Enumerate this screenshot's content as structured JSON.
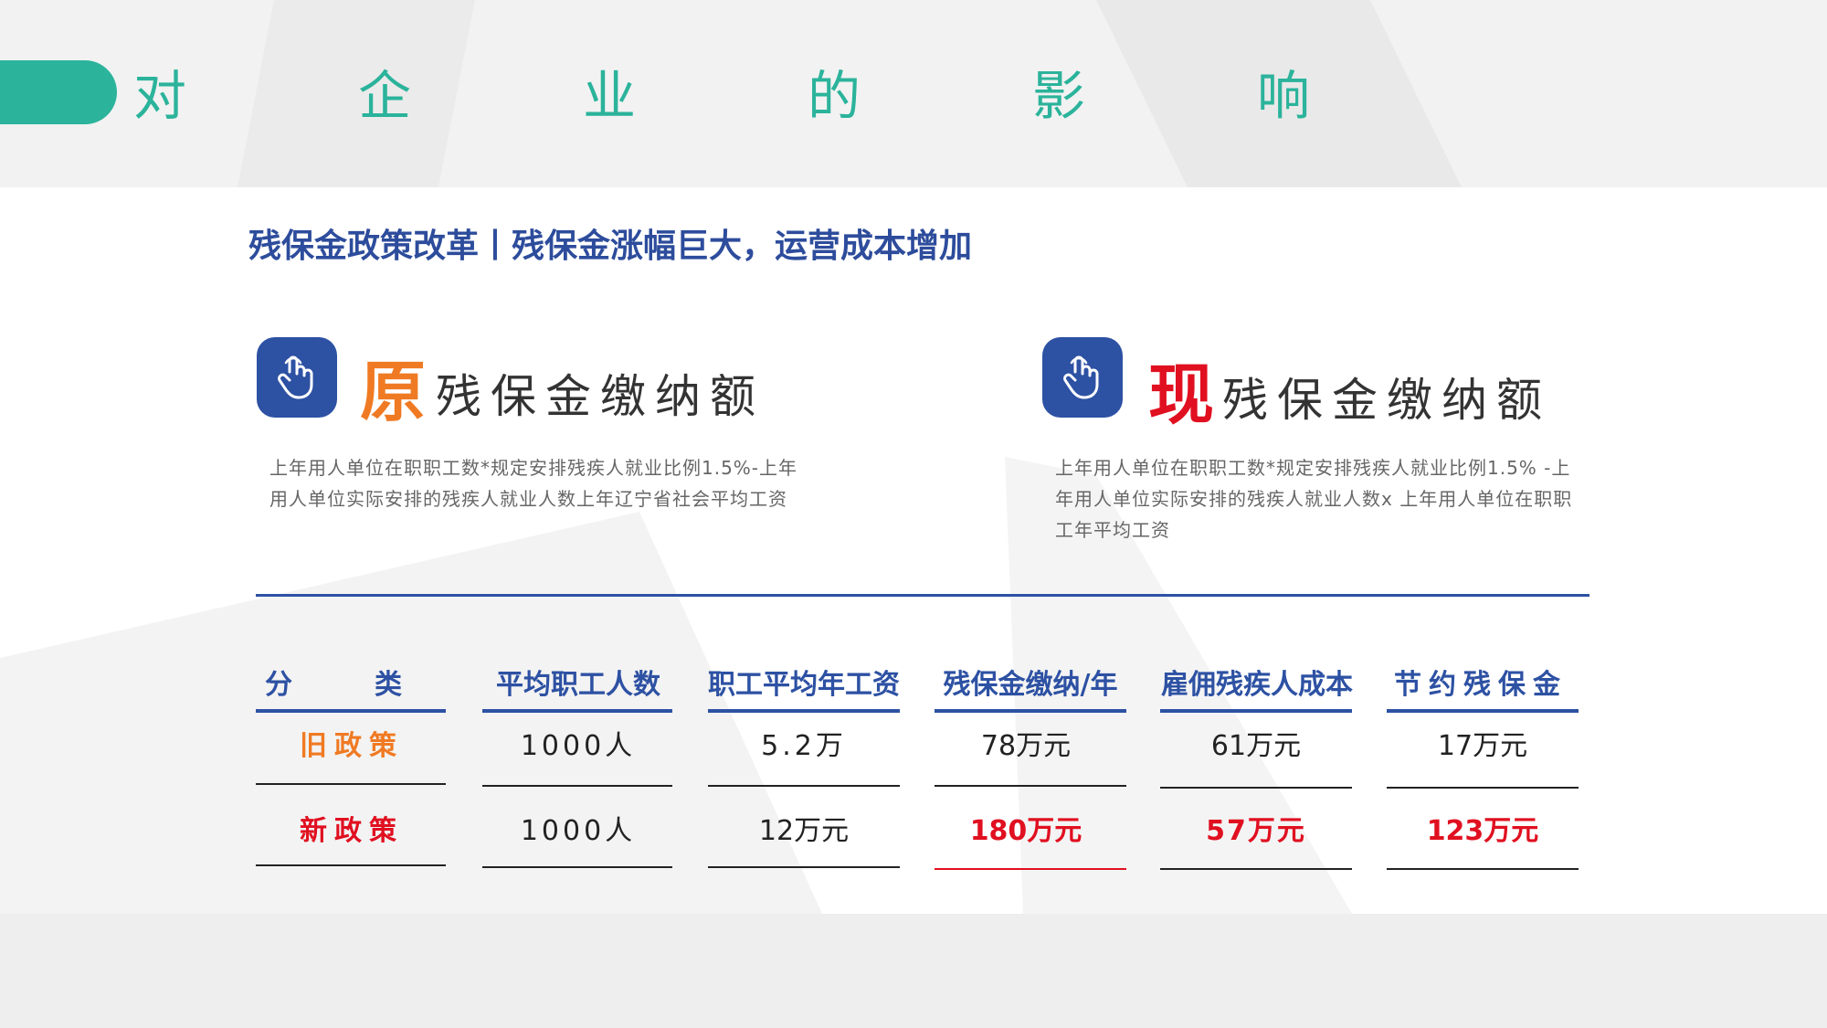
{
  "header": {
    "title_chars": [
      "对",
      "企",
      "业",
      "的",
      "影",
      "响"
    ],
    "subtitle": "残保金政策改革丨残保金涨幅巨大，运营成本增加"
  },
  "old_policy": {
    "icon": "hand-pointer-icon",
    "highlight_char": "原",
    "title_rest": "残保金缴纳额",
    "description": "上年用人单位在职职工数*规定安排残疾人就业比例1.5%-上年用人单位实际安排的残疾人就业人数上年辽宁省社会平均工资"
  },
  "new_policy": {
    "icon": "hand-pointer-icon",
    "highlight_char": "现",
    "title_rest": "残保金缴纳额",
    "description": "上年用人单位在职职工数*规定安排残疾人就业比例1.5% -上年用人单位实际安排的残疾人就业人数x 上年用人单位在职职工年平均工资"
  },
  "table": {
    "headers": [
      "分　　　类",
      "平均职工人数",
      "职工平均年工资",
      "残保金缴纳/年",
      "雇佣残疾人成本",
      "节约残保金"
    ],
    "rows": [
      {
        "label": "旧政策",
        "cells": [
          "1000人",
          "5.2万",
          "78万元",
          "61万元",
          "17万元"
        ]
      },
      {
        "label": "新政策",
        "cells": [
          "1000人",
          "12万元",
          "180万元",
          "57万元",
          "123万元"
        ]
      }
    ]
  },
  "colors": {
    "teal": "#2bb39b",
    "blue": "#2d51a3",
    "orange": "#f07a23",
    "red": "#e01020"
  }
}
